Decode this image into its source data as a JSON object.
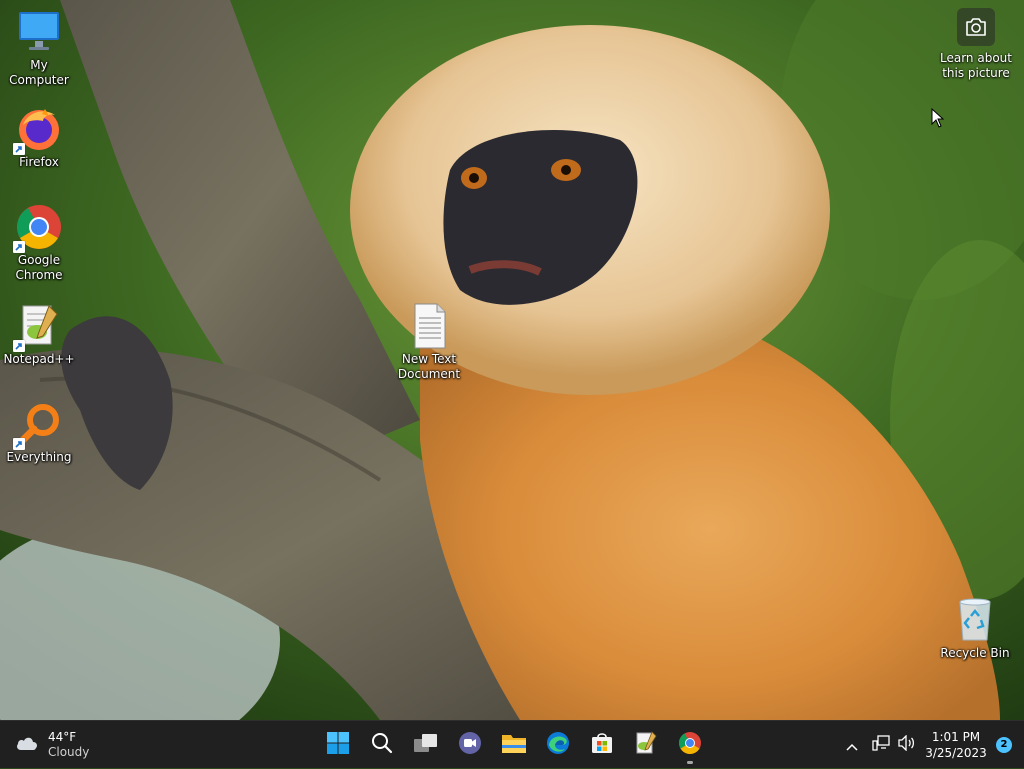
{
  "desktop": {
    "icons": [
      {
        "label": "My Computer",
        "icon": "monitor-icon"
      },
      {
        "label": "Firefox",
        "icon": "firefox-icon"
      },
      {
        "label": "Google Chrome",
        "icon": "chrome-icon"
      },
      {
        "label": "Notepad++",
        "icon": "notepadpp-icon"
      },
      {
        "label": "Everything",
        "icon": "everything-search-icon"
      },
      {
        "label": "New Text Document",
        "icon": "text-file-icon"
      },
      {
        "label": "Recycle Bin",
        "icon": "recycle-bin-icon"
      }
    ],
    "learn_picture": {
      "label": "Learn about this picture",
      "icon": "camera-icon"
    }
  },
  "taskbar": {
    "weather": {
      "temp": "44°F",
      "condition": "Cloudy",
      "icon": "cloud-icon"
    },
    "apps": [
      {
        "name": "Start",
        "icon": "windows-start-icon"
      },
      {
        "name": "Search",
        "icon": "search-icon"
      },
      {
        "name": "Task View",
        "icon": "task-view-icon"
      },
      {
        "name": "Chat",
        "icon": "teams-chat-icon"
      },
      {
        "name": "File Explorer",
        "icon": "folder-icon"
      },
      {
        "name": "Microsoft Edge",
        "icon": "edge-icon"
      },
      {
        "name": "Microsoft Store",
        "icon": "store-icon"
      },
      {
        "name": "Notepad++",
        "icon": "notepadpp-icon"
      },
      {
        "name": "Google Chrome",
        "icon": "chrome-icon",
        "active": true
      }
    ],
    "tray": {
      "time": "1:01 PM",
      "date": "3/25/2023",
      "notification_count": "2"
    }
  },
  "colors": {
    "taskbar_bg": "#202020",
    "accent": "#4cc2ff"
  }
}
